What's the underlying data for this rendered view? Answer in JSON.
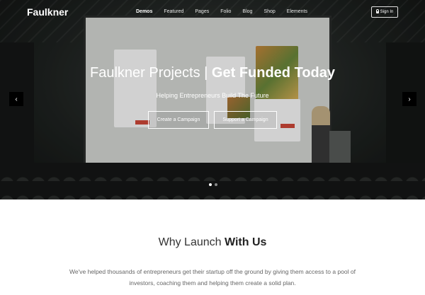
{
  "header": {
    "logo": "Faulkner",
    "nav": [
      {
        "label": "Demos",
        "active": true
      },
      {
        "label": "Featured",
        "active": false
      },
      {
        "label": "Pages",
        "active": false
      },
      {
        "label": "Folio",
        "active": false
      },
      {
        "label": "Blog",
        "active": false
      },
      {
        "label": "Shop",
        "active": false
      },
      {
        "label": "Elements",
        "active": false
      }
    ],
    "signin_label": "Sign In",
    "signin_icon": "lock-icon"
  },
  "hero": {
    "title_light": "Faulkner Projects | ",
    "title_bold": "Get Funded Today",
    "subtitle": "Helping Entrepreneurs Build The Future",
    "buttons": [
      "Create a Campaign",
      "Support a Campaign"
    ],
    "prev_icon": "chevron-left-icon",
    "next_icon": "chevron-right-icon",
    "slides": 2,
    "active_slide": 1
  },
  "why": {
    "title_light": "Why Launch ",
    "title_bold": "With Us",
    "text": "We've helped thousands of entrepreneurs get their startup off the ground by giving them access to a pool of investors, coaching them and helping them create a solid plan."
  }
}
